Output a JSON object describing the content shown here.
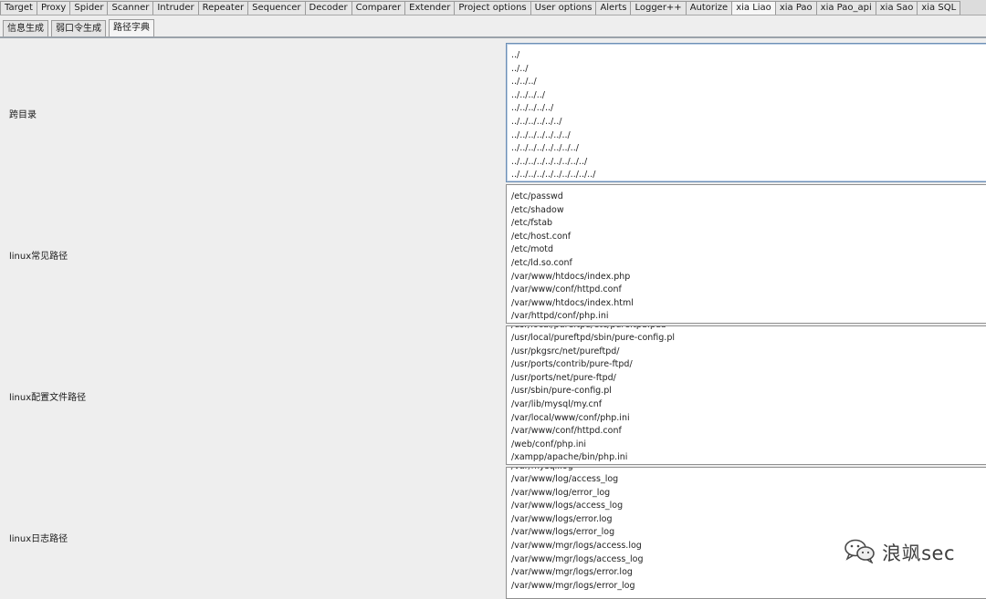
{
  "top_tabs": [
    "Target",
    "Proxy",
    "Spider",
    "Scanner",
    "Intruder",
    "Repeater",
    "Sequencer",
    "Decoder",
    "Comparer",
    "Extender",
    "Project options",
    "User options",
    "Alerts",
    "Logger++",
    "Autorize",
    "xia Liao",
    "xia Pao",
    "xia Pao_api",
    "xia Sao",
    "xia SQL"
  ],
  "top_tab_active": "xia Liao",
  "sub_tabs": [
    "信息生成",
    "弱口令生成",
    "路径字典"
  ],
  "sub_tab_active": "路径字典",
  "rows": [
    {
      "label": "跨目录",
      "partial_top": "",
      "lines": [
        "../",
        "../../",
        "../../../",
        "../../../../",
        "../../../../../",
        "../../../../../../",
        "../../../../../../../",
        "../../../../../../../../",
        "../../../../../../../../../",
        "../../../../../../../../../../"
      ]
    },
    {
      "label": "linux常见路径",
      "partial_top": "",
      "lines": [
        "/etc/passwd",
        "/etc/shadow",
        "/etc/fstab",
        "/etc/host.conf",
        "/etc/motd",
        "/etc/ld.so.conf",
        "/var/www/htdocs/index.php",
        "/var/www/conf/httpd.conf",
        "/var/www/htdocs/index.html",
        "/var/httpd/conf/php.ini"
      ]
    },
    {
      "label": "linux配置文件路径",
      "partial_top": "/usr/local/pureftpd/etc/pureftpd.pdb",
      "lines": [
        "/usr/local/pureftpd/sbin/pure-config.pl",
        "/usr/pkgsrc/net/pureftpd/",
        "/usr/ports/contrib/pure-ftpd/",
        "/usr/ports/net/pure-ftpd/",
        "/usr/sbin/pure-config.pl",
        "/var/lib/mysql/my.cnf",
        "/var/local/www/conf/php.ini",
        "/var/www/conf/httpd.conf",
        "/web/conf/php.ini",
        "/xampp/apache/bin/php.ini"
      ]
    },
    {
      "label": "linux日志路径",
      "partial_top": "/var/mysql.log",
      "lines": [
        "/var/www/log/access_log",
        "/var/www/log/error_log",
        "/var/www/logs/access_log",
        "/var/www/logs/error.log",
        "/var/www/logs/error_log",
        "/var/www/mgr/logs/access.log",
        "/var/www/mgr/logs/access_log",
        "/var/www/mgr/logs/error.log",
        "/var/www/mgr/logs/error_log"
      ]
    }
  ],
  "watermark": {
    "text": "浪飒sec",
    "icon": "wechat-icon"
  }
}
